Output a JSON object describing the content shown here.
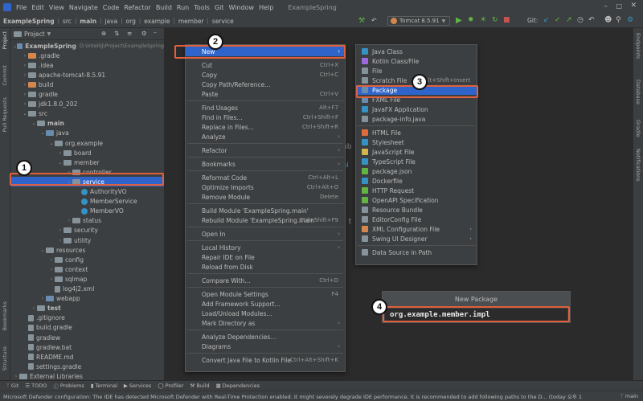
{
  "menubar": {
    "items": [
      "File",
      "Edit",
      "View",
      "Navigate",
      "Code",
      "Refactor",
      "Build",
      "Run",
      "Tools",
      "Git",
      "Window",
      "Help"
    ],
    "window_title": "ExampleSpring"
  },
  "navbar": {
    "crumbs": [
      "ExampleSpring",
      "src",
      "main",
      "java",
      "org",
      "example",
      "member",
      "service"
    ],
    "run_config": "Tomcat 8.5.91",
    "git_label": "Git:"
  },
  "left_strip": [
    "Project",
    "Commit",
    "Pull Requests",
    "Bookmarks",
    "Structure"
  ],
  "right_strip": [
    "Endpoints",
    "Database",
    "Gradle",
    "Notifications"
  ],
  "project_panel": {
    "title": "Project",
    "tree": [
      {
        "label": "ExampleSpring",
        "extra": "D:\\IntelliJ\\Project\\ExampleSpring",
        "depth": 0,
        "arrow": "v",
        "icon": "folder-blue"
      },
      {
        "label": ".gradle",
        "depth": 1,
        "arrow": ">",
        "icon": "folder-orange"
      },
      {
        "label": ".idea",
        "depth": 1,
        "arrow": ">",
        "icon": "folder-grey"
      },
      {
        "label": "apache-tomcat-8.5.91",
        "depth": 1,
        "arrow": ">",
        "icon": "folder-grey"
      },
      {
        "label": "build",
        "depth": 1,
        "arrow": ">",
        "icon": "folder-orange"
      },
      {
        "label": "gradle",
        "depth": 1,
        "arrow": ">",
        "icon": "folder-grey"
      },
      {
        "label": "jdk1.8.0_202",
        "depth": 1,
        "arrow": ">",
        "icon": "folder-grey"
      },
      {
        "label": "src",
        "depth": 1,
        "arrow": "v",
        "icon": "folder-grey"
      },
      {
        "label": "main",
        "depth": 2,
        "arrow": "v",
        "icon": "folder-grey"
      },
      {
        "label": "java",
        "depth": 3,
        "arrow": "v",
        "icon": "folder-blue"
      },
      {
        "label": "org.example",
        "depth": 4,
        "arrow": "v",
        "icon": "folder-grey"
      },
      {
        "label": "board",
        "depth": 5,
        "arrow": ">",
        "icon": "folder-grey"
      },
      {
        "label": "member",
        "depth": 5,
        "arrow": "v",
        "icon": "folder-grey"
      },
      {
        "label": "controller",
        "depth": 6,
        "arrow": ">",
        "icon": "folder-grey"
      },
      {
        "label": "service",
        "depth": 6,
        "arrow": "v",
        "icon": "folder-grey",
        "selected": true
      },
      {
        "label": "AuthorityVO",
        "depth": 7,
        "arrow": "",
        "icon": "class"
      },
      {
        "label": "MemberService",
        "depth": 7,
        "arrow": "",
        "icon": "class"
      },
      {
        "label": "MemberVO",
        "depth": 7,
        "arrow": "",
        "icon": "class"
      },
      {
        "label": "status",
        "depth": 6,
        "arrow": ">",
        "icon": "folder-grey"
      },
      {
        "label": "security",
        "depth": 5,
        "arrow": ">",
        "icon": "folder-grey"
      },
      {
        "label": "utility",
        "depth": 5,
        "arrow": ">",
        "icon": "folder-grey"
      },
      {
        "label": "resources",
        "depth": 3,
        "arrow": "v",
        "icon": "folder-grey"
      },
      {
        "label": "config",
        "depth": 4,
        "arrow": ">",
        "icon": "folder-grey"
      },
      {
        "label": "context",
        "depth": 4,
        "arrow": ">",
        "icon": "folder-grey"
      },
      {
        "label": "sqlmap",
        "depth": 4,
        "arrow": ">",
        "icon": "folder-grey"
      },
      {
        "label": "log4j2.xml",
        "depth": 4,
        "arrow": "",
        "icon": "file"
      },
      {
        "label": "webapp",
        "depth": 3,
        "arrow": ">",
        "icon": "folder-blue"
      },
      {
        "label": "test",
        "depth": 2,
        "arrow": ">",
        "icon": "folder-grey"
      },
      {
        "label": ".gitignore",
        "depth": 1,
        "arrow": "",
        "icon": "file"
      },
      {
        "label": "build.gradle",
        "depth": 1,
        "arrow": "",
        "icon": "file"
      },
      {
        "label": "gradlew",
        "depth": 1,
        "arrow": "",
        "icon": "file"
      },
      {
        "label": "gradlew.bat",
        "depth": 1,
        "arrow": "",
        "icon": "file"
      },
      {
        "label": "README.md",
        "depth": 1,
        "arrow": "",
        "icon": "file"
      },
      {
        "label": "settings.gradle",
        "depth": 1,
        "arrow": "",
        "icon": "file"
      },
      {
        "label": "External Libraries",
        "depth": 0,
        "arrow": ">",
        "icon": "folder-grey"
      }
    ]
  },
  "context_menu": {
    "items": [
      {
        "label": "New",
        "shortcut": "",
        "submenu": true,
        "selected": true
      },
      {
        "sep": true
      },
      {
        "label": "Cut",
        "shortcut": "Ctrl+X"
      },
      {
        "label": "Copy",
        "shortcut": "Ctrl+C"
      },
      {
        "label": "Copy Path/Reference...",
        "shortcut": ""
      },
      {
        "label": "Paste",
        "shortcut": "Ctrl+V"
      },
      {
        "sep": true
      },
      {
        "label": "Find Usages",
        "shortcut": "Alt+F7"
      },
      {
        "label": "Find in Files...",
        "shortcut": "Ctrl+Shift+F"
      },
      {
        "label": "Replace in Files...",
        "shortcut": "Ctrl+Shift+R"
      },
      {
        "label": "Analyze",
        "shortcut": "",
        "submenu": true
      },
      {
        "sep": true
      },
      {
        "label": "Refactor",
        "shortcut": "",
        "submenu": true
      },
      {
        "sep": true
      },
      {
        "label": "Bookmarks",
        "shortcut": "",
        "submenu": true
      },
      {
        "sep": true
      },
      {
        "label": "Reformat Code",
        "shortcut": "Ctrl+Alt+L"
      },
      {
        "label": "Optimize Imports",
        "shortcut": "Ctrl+Alt+O"
      },
      {
        "label": "Remove Module",
        "shortcut": "Delete"
      },
      {
        "sep": true
      },
      {
        "label": "Build Module 'ExampleSpring.main'",
        "shortcut": ""
      },
      {
        "label": "Rebuild Module 'ExampleSpring.main'",
        "shortcut": "Ctrl+Shift+F9"
      },
      {
        "sep": true
      },
      {
        "label": "Open In",
        "shortcut": "",
        "submenu": true
      },
      {
        "sep": true
      },
      {
        "label": "Local History",
        "shortcut": "",
        "submenu": true
      },
      {
        "label": "Repair IDE on File",
        "shortcut": ""
      },
      {
        "label": "Reload from Disk",
        "shortcut": ""
      },
      {
        "sep": true
      },
      {
        "label": "Compare With...",
        "shortcut": "Ctrl+D"
      },
      {
        "sep": true
      },
      {
        "label": "Open Module Settings",
        "shortcut": "F4"
      },
      {
        "label": "Add Framework Support...",
        "shortcut": ""
      },
      {
        "label": "Load/Unload Modules...",
        "shortcut": ""
      },
      {
        "label": "Mark Directory as",
        "shortcut": "",
        "submenu": true
      },
      {
        "sep": true
      },
      {
        "label": "Analyze Dependencies...",
        "shortcut": ""
      },
      {
        "label": "Diagrams",
        "shortcut": "",
        "submenu": true
      },
      {
        "sep": true
      },
      {
        "label": "Convert Java File to Kotlin File",
        "shortcut": "Ctrl+Alt+Shift+K"
      }
    ]
  },
  "new_submenu": {
    "items": [
      {
        "label": "Java Class",
        "color": "#3592c4"
      },
      {
        "label": "Kotlin Class/File",
        "color": "#9c6ade"
      },
      {
        "label": "File",
        "color": "#87939a"
      },
      {
        "label": "Scratch File",
        "shortcut": "Alt+Shift+Insert",
        "color": "#87939a"
      },
      {
        "label": "Package",
        "selected": true,
        "color": "#6a8caf"
      },
      {
        "label": "FXML File",
        "color": "#6a8caf"
      },
      {
        "label": "JavaFX Application",
        "color": "#3592c4"
      },
      {
        "label": "package-info.java",
        "color": "#87939a"
      },
      {
        "sep": true
      },
      {
        "label": "HTML File",
        "color": "#e06c3d"
      },
      {
        "label": "Stylesheet",
        "color": "#3592c4"
      },
      {
        "label": "JavaScript File",
        "color": "#d4b44d"
      },
      {
        "label": "TypeScript File",
        "color": "#3592c4"
      },
      {
        "label": "package.json",
        "color": "#62b543"
      },
      {
        "label": "Dockerfile",
        "color": "#3592c4"
      },
      {
        "label": "HTTP Request",
        "color": "#62b543"
      },
      {
        "label": "OpenAPI Specification",
        "color": "#62b543"
      },
      {
        "label": "Resource Bundle",
        "color": "#87939a"
      },
      {
        "label": "EditorConfig File",
        "color": "#87939a"
      },
      {
        "label": "XML Configuration File",
        "submenu": true,
        "color": "#d4874d"
      },
      {
        "label": "Swing UI Designer",
        "submenu": true,
        "color": "#87939a"
      },
      {
        "sep": true
      },
      {
        "label": "Data Source in Path",
        "color": "#87939a"
      }
    ]
  },
  "new_package_dialog": {
    "title": "New Package",
    "value": "org.example.member.impl"
  },
  "badges": [
    "1",
    "2",
    "3",
    "4"
  ],
  "bottom_tabs": [
    "Git",
    "TODO",
    "Problems",
    "Terminal",
    "Services",
    "Profiler",
    "Build",
    "Dependencies"
  ],
  "status": {
    "message": "Microsoft Defender configuration: The IDE has detected Microsoft Defender with Real-Time Protection enabled. It might severely degrade IDE performance. It is recommended to add following paths to the D... (today 오후 1",
    "branch": "main"
  },
  "editor_hints": [
    "ub",
    "N",
    "n t"
  ]
}
